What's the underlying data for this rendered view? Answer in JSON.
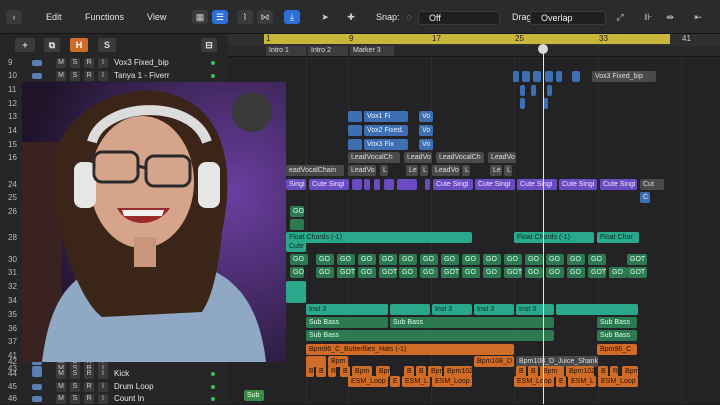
{
  "toolbar": {
    "edit": "Edit",
    "functions": "Functions",
    "view": "View",
    "snap_label": "Snap:",
    "snap_value": "Off",
    "drag_label": "Drag:",
    "drag_value": "Overlap"
  },
  "header_buttons": {
    "add": "+",
    "h": "H",
    "s": "S"
  },
  "ruler": {
    "bars": [
      "1",
      "9",
      "17",
      "25",
      "33",
      "41"
    ]
  },
  "markers": [
    "Intro 1",
    "Intro 2",
    "Marker 3"
  ],
  "tracks": [
    {
      "num": "9",
      "name": "Vox3 Fixed_bip"
    },
    {
      "num": "10",
      "name": "Tanya 1 - Fiverr"
    },
    {
      "num": "11",
      "name": ""
    },
    {
      "num": "12",
      "name": ""
    },
    {
      "num": "13",
      "name": ""
    },
    {
      "num": "14",
      "name": ""
    },
    {
      "num": "15",
      "name": ""
    },
    {
      "num": "16",
      "name": ""
    },
    {
      "num": "24",
      "name": ""
    },
    {
      "num": "25",
      "name": ""
    },
    {
      "num": "26",
      "name": ""
    },
    {
      "num": "28",
      "name": ""
    },
    {
      "num": "30",
      "name": ""
    },
    {
      "num": "31",
      "name": ""
    },
    {
      "num": "32",
      "name": ""
    },
    {
      "num": "34",
      "name": ""
    },
    {
      "num": "35",
      "name": ""
    },
    {
      "num": "36",
      "name": ""
    },
    {
      "num": "37",
      "name": ""
    },
    {
      "num": "41",
      "name": ""
    },
    {
      "num": "42",
      "name": ""
    },
    {
      "num": "43",
      "name": ""
    },
    {
      "num": "44",
      "name": "Kick"
    },
    {
      "num": "45",
      "name": "Drum Loop"
    },
    {
      "num": "46",
      "name": "Count In"
    }
  ],
  "msri": [
    "M",
    "S",
    "R",
    "I"
  ],
  "regions": {
    "vox3": "Vox3 Fixed_bip",
    "vox1": "Vox1 Fi",
    "vox2": "Vox2 Fixed.",
    "vox3b": "Vox3 Fix",
    "vo": "Vo",
    "leadvocal_ch": "LeadVocalCh",
    "leadvo": "LeadVo",
    "leadvocalchain": "eadVocalChain",
    "leadvo2": "LeadVo",
    "l": "L",
    "le": "Le",
    "cute_singi": "Cute Singi",
    "singi": "Singi",
    "cut": "Cut",
    "c": "C",
    "go": "GO",
    "got": "GOT",
    "cute": "Cute",
    "float1": "Float Chords (-1)",
    "float2": "Float Chords (-1)",
    "float3": "Float Chor",
    "inst3": "Inst 3",
    "sub_bass": "Sub Bass",
    "bpm96_1": "Bpm96_C_Butterflies_Hats (-1)",
    "bpm96_2": "Bpm96_C",
    "bpm": "Bpm",
    "bpm108": "Bpm108_D",
    "bpm108_juice": "Bpm108_D_Juice_Shank_02.21",
    "bpm102": "Bpm102",
    "b": "B",
    "r": "R",
    "e": "E",
    "esm_loop": "ESM_Loop",
    "esm_l": "ESM_L",
    "sub": "Sub",
    "kick": "Kick"
  },
  "colors": {
    "accent": "#2f6fd8",
    "cycle": "#c9b73a",
    "blue_region": "#3f6fb3",
    "purple_region": "#6a4bc2",
    "teal_region": "#2aa88c",
    "orange_region": "#d06c28",
    "green_region": "#3c8a4a"
  }
}
